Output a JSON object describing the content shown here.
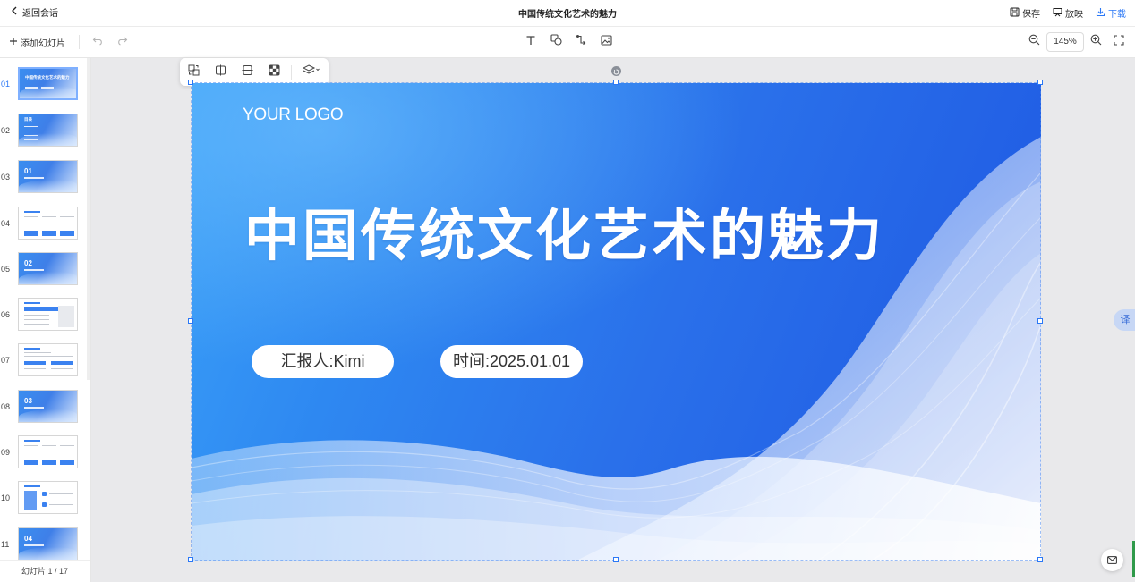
{
  "header": {
    "back_label": "返回会话",
    "title": "中国传统文化艺术的魅力",
    "save_label": "保存",
    "present_label": "放映",
    "download_label": "下载"
  },
  "toolbar": {
    "add_slide_label": "添加幻灯片",
    "zoom": "145%",
    "tools": [
      "text-icon",
      "shape-icon",
      "connector-icon",
      "image-icon"
    ]
  },
  "sidebar": {
    "slides": [
      {
        "num": "01",
        "title": "中国传统文化艺术的魅力",
        "active": true
      },
      {
        "num": "02",
        "title": "目录"
      },
      {
        "num": "03",
        "title": "01"
      },
      {
        "num": "04",
        "title": ""
      },
      {
        "num": "05",
        "title": "02"
      },
      {
        "num": "06",
        "title": ""
      },
      {
        "num": "07",
        "title": ""
      },
      {
        "num": "08",
        "title": "03"
      },
      {
        "num": "09",
        "title": ""
      },
      {
        "num": "10",
        "title": ""
      },
      {
        "num": "11",
        "title": "04"
      }
    ],
    "footer": "幻灯片 1 / 17"
  },
  "slide": {
    "logo": "YOUR LOGO",
    "title": "中国传统文化艺术的魅力",
    "reporter": "汇报人:Kimi",
    "date": "时间:2025.01.01"
  },
  "side_buttons": {
    "translate": "译"
  },
  "colors": {
    "accent": "#2b78f6",
    "slide_blue": "#2a70ea"
  }
}
